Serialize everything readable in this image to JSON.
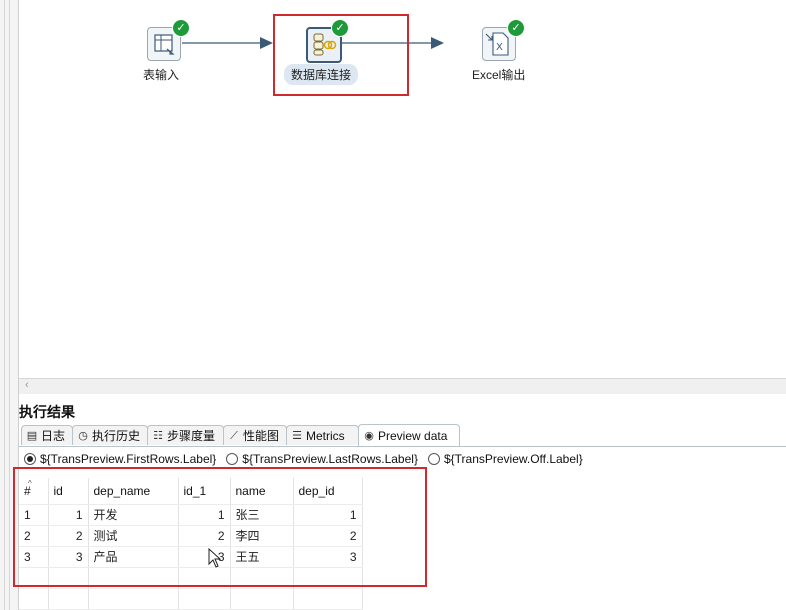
{
  "steps": [
    {
      "name": "表输入"
    },
    {
      "name": "数据库连接"
    },
    {
      "name": "Excel输出"
    }
  ],
  "panel_title": "执行结果",
  "tabs": [
    {
      "label": "日志",
      "icon": "log-icon"
    },
    {
      "label": "执行历史",
      "icon": "history-icon"
    },
    {
      "label": "步骤度量",
      "icon": "metrics-list-icon"
    },
    {
      "label": "性能图",
      "icon": "chart-icon"
    },
    {
      "label": "Metrics",
      "icon": "metrics-icon"
    },
    {
      "label": "Preview data",
      "icon": "eye-icon",
      "active": true
    }
  ],
  "preview_options": [
    {
      "label": "${TransPreview.FirstRows.Label}",
      "selected": true
    },
    {
      "label": "${TransPreview.LastRows.Label}",
      "selected": false
    },
    {
      "label": "${TransPreview.Off.Label}",
      "selected": false
    }
  ],
  "table": {
    "columns": [
      "#",
      "id",
      "dep_name",
      "id_1",
      "name",
      "dep_id"
    ],
    "rows": [
      [
        "1",
        "1",
        "开发",
        "1",
        "张三",
        "1"
      ],
      [
        "2",
        "2",
        "测试",
        "2",
        "李四",
        "2"
      ],
      [
        "3",
        "3",
        "产品",
        "3",
        "王五",
        "3"
      ]
    ]
  },
  "colors": {
    "ok": "#1f9a3a",
    "highlight": "#d0282f",
    "hop": "#3b5a78"
  }
}
